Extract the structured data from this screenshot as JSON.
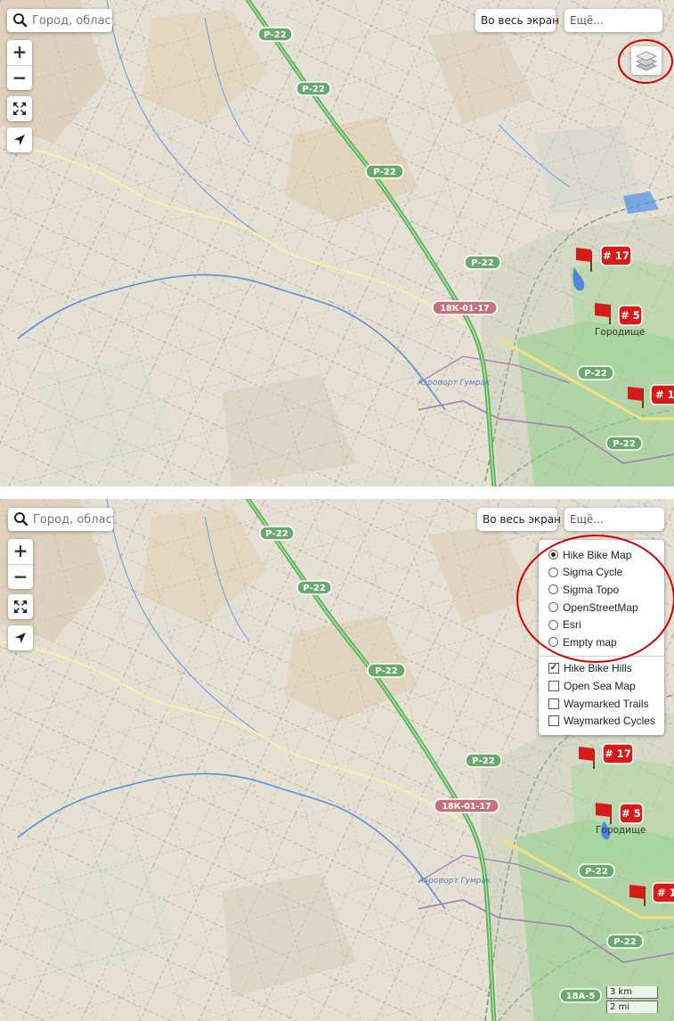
{
  "search": {
    "placeholder": "Город, область"
  },
  "zoom": {
    "in_label": "+",
    "out_label": "−"
  },
  "toolbar": {
    "fullscreen_label": "Во весь экран",
    "more_label": "Ещё..."
  },
  "map_labels": {
    "road_p22": "Р-22",
    "road_18k": "18К-01-17",
    "road_18a": "18А-5",
    "airport": "Аэропорт Гумрак",
    "town": "Городище",
    "marker_17": "# 17",
    "marker_5": "# 5",
    "marker_1": "# 1"
  },
  "layer_menu": {
    "base_layers": [
      {
        "label": "Hike Bike Map",
        "selected": true
      },
      {
        "label": "Sigma Cycle",
        "selected": false
      },
      {
        "label": "Sigma Topo",
        "selected": false
      },
      {
        "label": "OpenStreetMap",
        "selected": false
      },
      {
        "label": "Esri",
        "selected": false
      },
      {
        "label": "Empty map",
        "selected": false
      }
    ],
    "overlays": [
      {
        "label": "Hike Bike Hills",
        "checked": true
      },
      {
        "label": "Open Sea Map",
        "checked": false
      },
      {
        "label": "Waymarked Trails",
        "checked": false
      },
      {
        "label": "Waymarked Cycles",
        "checked": false
      }
    ]
  },
  "scale": {
    "metric": "3 km",
    "imperial": "2 mi"
  },
  "colors": {
    "highlight": "#d40000",
    "marker": "#d71a1a",
    "highway": "#58b15a",
    "road_badge": "#6aa86f",
    "urban": "#8ccf8a",
    "water": "#3e8ee0"
  }
}
